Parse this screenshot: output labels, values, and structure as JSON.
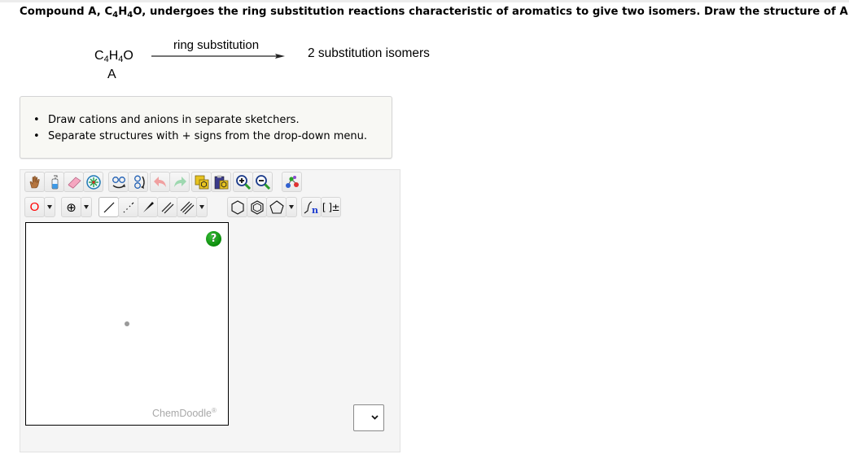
{
  "question": {
    "parts": [
      "Compound A, C",
      "4",
      "H",
      "4",
      "O, undergoes the ring substitution reactions characteristic of aromatics to give two isomers. Draw the structure of A."
    ]
  },
  "scheme": {
    "formula": {
      "c": "C",
      "c_sub": "4",
      "h": "H",
      "h_sub": "4",
      "o": "O"
    },
    "compound_label": "A",
    "arrow_label": "ring substitution",
    "product": "2 substitution isomers"
  },
  "instructions": [
    "Draw cations and anions in separate sketchers.",
    "Separate structures with + signs from the drop-down menu."
  ],
  "sketcher": {
    "toolbar_row1": [
      {
        "name": "hand-tool",
        "icon": "hand-icon"
      },
      {
        "name": "clear-tool",
        "icon": "wash-bottle-icon"
      },
      {
        "name": "eraser-tool",
        "icon": "eraser-icon"
      },
      {
        "name": "center-tool",
        "icon": "center-icon"
      },
      {
        "name": "flip-horizontal-tool",
        "icon": "flip-horizontal-icon"
      },
      {
        "name": "flip-vertical-tool",
        "icon": "flip-vertical-icon"
      },
      {
        "name": "undo",
        "icon": "undo-icon"
      },
      {
        "name": "redo",
        "icon": "redo-icon"
      },
      {
        "name": "copy",
        "icon": "copy-icon"
      },
      {
        "name": "paste",
        "icon": "paste-icon"
      },
      {
        "name": "zoom-in",
        "icon": "zoom-in-icon"
      },
      {
        "name": "zoom-out",
        "icon": "zoom-out-icon"
      },
      {
        "name": "clean",
        "icon": "clean-structure-icon"
      }
    ],
    "atom_label": "O",
    "charge_label": "⊕",
    "bracket_label": "[ ]±",
    "polymer_label": "n",
    "brand": "ChemDoodle",
    "brand_mark": "®",
    "help_label": "?",
    "separator_select_value": ""
  },
  "colors": {
    "atom_red": "#ff0000",
    "help_green": "#0a8a0a",
    "panel_bg": "#f5f5f5",
    "info_bg": "#f8f8f4"
  }
}
